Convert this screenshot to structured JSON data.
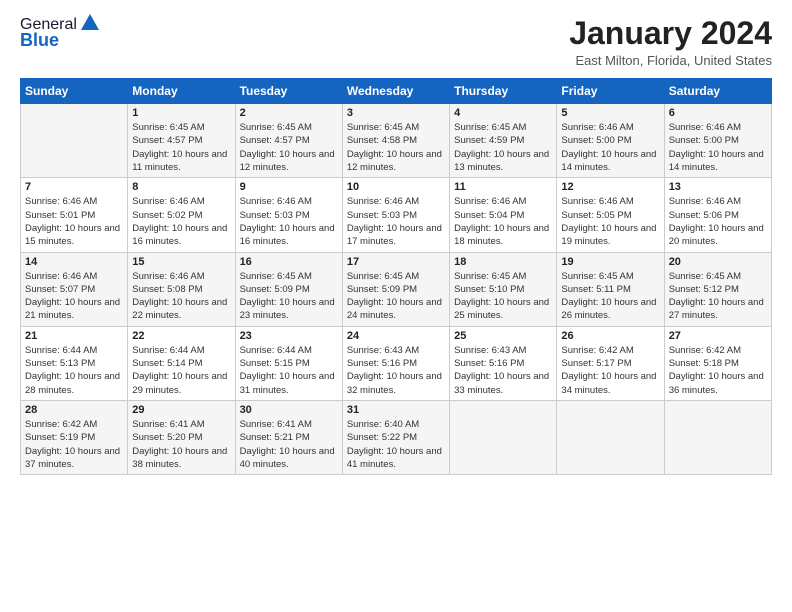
{
  "logo": {
    "general": "General",
    "blue": "Blue"
  },
  "title": "January 2024",
  "subtitle": "East Milton, Florida, United States",
  "days_header": [
    "Sunday",
    "Monday",
    "Tuesday",
    "Wednesday",
    "Thursday",
    "Friday",
    "Saturday"
  ],
  "weeks": [
    [
      {
        "day": "",
        "sunrise": "",
        "sunset": "",
        "daylight": ""
      },
      {
        "day": "1",
        "sunrise": "Sunrise: 6:45 AM",
        "sunset": "Sunset: 4:57 PM",
        "daylight": "Daylight: 10 hours and 11 minutes."
      },
      {
        "day": "2",
        "sunrise": "Sunrise: 6:45 AM",
        "sunset": "Sunset: 4:57 PM",
        "daylight": "Daylight: 10 hours and 12 minutes."
      },
      {
        "day": "3",
        "sunrise": "Sunrise: 6:45 AM",
        "sunset": "Sunset: 4:58 PM",
        "daylight": "Daylight: 10 hours and 12 minutes."
      },
      {
        "day": "4",
        "sunrise": "Sunrise: 6:45 AM",
        "sunset": "Sunset: 4:59 PM",
        "daylight": "Daylight: 10 hours and 13 minutes."
      },
      {
        "day": "5",
        "sunrise": "Sunrise: 6:46 AM",
        "sunset": "Sunset: 5:00 PM",
        "daylight": "Daylight: 10 hours and 14 minutes."
      },
      {
        "day": "6",
        "sunrise": "Sunrise: 6:46 AM",
        "sunset": "Sunset: 5:00 PM",
        "daylight": "Daylight: 10 hours and 14 minutes."
      }
    ],
    [
      {
        "day": "7",
        "sunrise": "Sunrise: 6:46 AM",
        "sunset": "Sunset: 5:01 PM",
        "daylight": "Daylight: 10 hours and 15 minutes."
      },
      {
        "day": "8",
        "sunrise": "Sunrise: 6:46 AM",
        "sunset": "Sunset: 5:02 PM",
        "daylight": "Daylight: 10 hours and 16 minutes."
      },
      {
        "day": "9",
        "sunrise": "Sunrise: 6:46 AM",
        "sunset": "Sunset: 5:03 PM",
        "daylight": "Daylight: 10 hours and 16 minutes."
      },
      {
        "day": "10",
        "sunrise": "Sunrise: 6:46 AM",
        "sunset": "Sunset: 5:03 PM",
        "daylight": "Daylight: 10 hours and 17 minutes."
      },
      {
        "day": "11",
        "sunrise": "Sunrise: 6:46 AM",
        "sunset": "Sunset: 5:04 PM",
        "daylight": "Daylight: 10 hours and 18 minutes."
      },
      {
        "day": "12",
        "sunrise": "Sunrise: 6:46 AM",
        "sunset": "Sunset: 5:05 PM",
        "daylight": "Daylight: 10 hours and 19 minutes."
      },
      {
        "day": "13",
        "sunrise": "Sunrise: 6:46 AM",
        "sunset": "Sunset: 5:06 PM",
        "daylight": "Daylight: 10 hours and 20 minutes."
      }
    ],
    [
      {
        "day": "14",
        "sunrise": "Sunrise: 6:46 AM",
        "sunset": "Sunset: 5:07 PM",
        "daylight": "Daylight: 10 hours and 21 minutes."
      },
      {
        "day": "15",
        "sunrise": "Sunrise: 6:46 AM",
        "sunset": "Sunset: 5:08 PM",
        "daylight": "Daylight: 10 hours and 22 minutes."
      },
      {
        "day": "16",
        "sunrise": "Sunrise: 6:45 AM",
        "sunset": "Sunset: 5:09 PM",
        "daylight": "Daylight: 10 hours and 23 minutes."
      },
      {
        "day": "17",
        "sunrise": "Sunrise: 6:45 AM",
        "sunset": "Sunset: 5:09 PM",
        "daylight": "Daylight: 10 hours and 24 minutes."
      },
      {
        "day": "18",
        "sunrise": "Sunrise: 6:45 AM",
        "sunset": "Sunset: 5:10 PM",
        "daylight": "Daylight: 10 hours and 25 minutes."
      },
      {
        "day": "19",
        "sunrise": "Sunrise: 6:45 AM",
        "sunset": "Sunset: 5:11 PM",
        "daylight": "Daylight: 10 hours and 26 minutes."
      },
      {
        "day": "20",
        "sunrise": "Sunrise: 6:45 AM",
        "sunset": "Sunset: 5:12 PM",
        "daylight": "Daylight: 10 hours and 27 minutes."
      }
    ],
    [
      {
        "day": "21",
        "sunrise": "Sunrise: 6:44 AM",
        "sunset": "Sunset: 5:13 PM",
        "daylight": "Daylight: 10 hours and 28 minutes."
      },
      {
        "day": "22",
        "sunrise": "Sunrise: 6:44 AM",
        "sunset": "Sunset: 5:14 PM",
        "daylight": "Daylight: 10 hours and 29 minutes."
      },
      {
        "day": "23",
        "sunrise": "Sunrise: 6:44 AM",
        "sunset": "Sunset: 5:15 PM",
        "daylight": "Daylight: 10 hours and 31 minutes."
      },
      {
        "day": "24",
        "sunrise": "Sunrise: 6:43 AM",
        "sunset": "Sunset: 5:16 PM",
        "daylight": "Daylight: 10 hours and 32 minutes."
      },
      {
        "day": "25",
        "sunrise": "Sunrise: 6:43 AM",
        "sunset": "Sunset: 5:16 PM",
        "daylight": "Daylight: 10 hours and 33 minutes."
      },
      {
        "day": "26",
        "sunrise": "Sunrise: 6:42 AM",
        "sunset": "Sunset: 5:17 PM",
        "daylight": "Daylight: 10 hours and 34 minutes."
      },
      {
        "day": "27",
        "sunrise": "Sunrise: 6:42 AM",
        "sunset": "Sunset: 5:18 PM",
        "daylight": "Daylight: 10 hours and 36 minutes."
      }
    ],
    [
      {
        "day": "28",
        "sunrise": "Sunrise: 6:42 AM",
        "sunset": "Sunset: 5:19 PM",
        "daylight": "Daylight: 10 hours and 37 minutes."
      },
      {
        "day": "29",
        "sunrise": "Sunrise: 6:41 AM",
        "sunset": "Sunset: 5:20 PM",
        "daylight": "Daylight: 10 hours and 38 minutes."
      },
      {
        "day": "30",
        "sunrise": "Sunrise: 6:41 AM",
        "sunset": "Sunset: 5:21 PM",
        "daylight": "Daylight: 10 hours and 40 minutes."
      },
      {
        "day": "31",
        "sunrise": "Sunrise: 6:40 AM",
        "sunset": "Sunset: 5:22 PM",
        "daylight": "Daylight: 10 hours and 41 minutes."
      },
      {
        "day": "",
        "sunrise": "",
        "sunset": "",
        "daylight": ""
      },
      {
        "day": "",
        "sunrise": "",
        "sunset": "",
        "daylight": ""
      },
      {
        "day": "",
        "sunrise": "",
        "sunset": "",
        "daylight": ""
      }
    ]
  ]
}
